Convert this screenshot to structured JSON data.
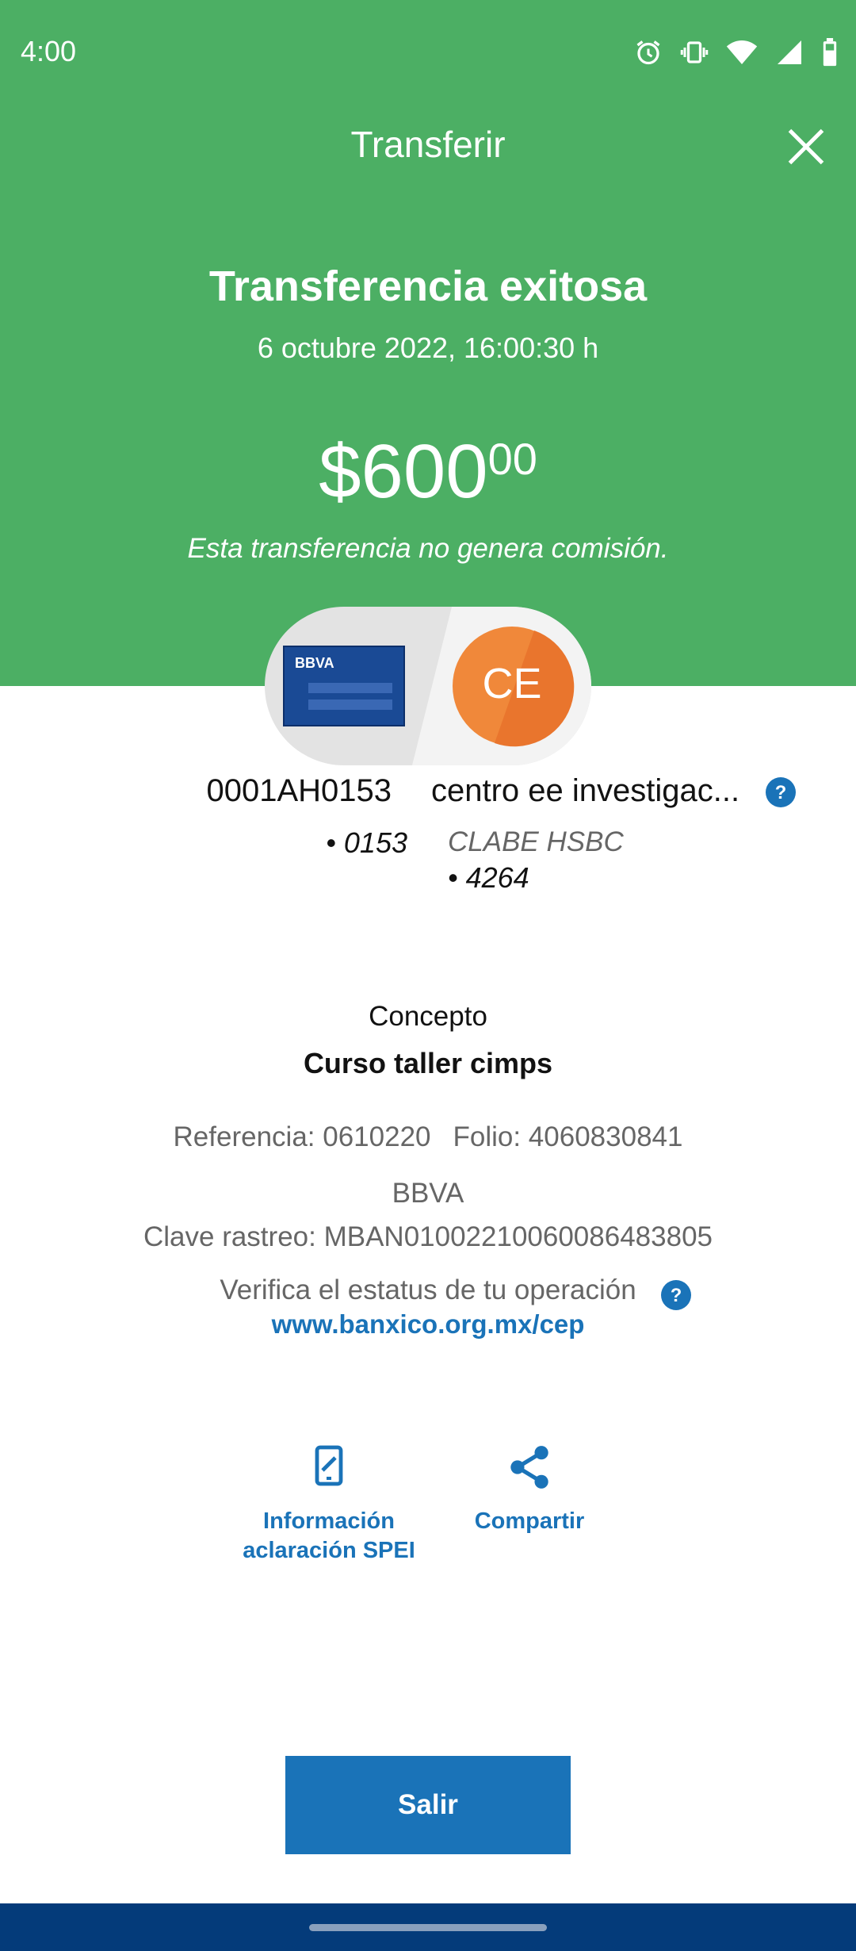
{
  "status_bar": {
    "time": "4:00"
  },
  "header": {
    "title": "Transferir"
  },
  "result": {
    "title": "Transferencia exitosa",
    "date": "6 octubre 2022, 16:00:30 h",
    "amount_main": "$600",
    "amount_cents": "00",
    "commission_note": "Esta transferencia no genera comisión."
  },
  "origin": {
    "card_brand": "BBVA",
    "name": "0001AH0153",
    "number": "• 0153"
  },
  "destination": {
    "initials": "CE",
    "name": "centro ee investigac...",
    "bank": "CLABE HSBC",
    "number": "• 4264"
  },
  "concept": {
    "label": "Concepto",
    "value": "Curso taller cimps"
  },
  "details": {
    "referencia": "Referencia: 0610220",
    "folio": "Folio: 4060830841",
    "bank": "BBVA",
    "clave_rastreo": "Clave rastreo: MBAN01002210060086483805"
  },
  "verify": {
    "text": "Verifica el estatus de tu operación",
    "link": "www.banxico.org.mx/cep"
  },
  "actions": {
    "info_line1": "Información",
    "info_line2": "aclaración SPEI",
    "share": "Compartir"
  },
  "exit_button": "Salir",
  "colors": {
    "header_green": "#4caf64",
    "primary_blue": "#1a73b8",
    "nav_blue": "#043b7a",
    "avatar_orange": "#f0883a"
  }
}
